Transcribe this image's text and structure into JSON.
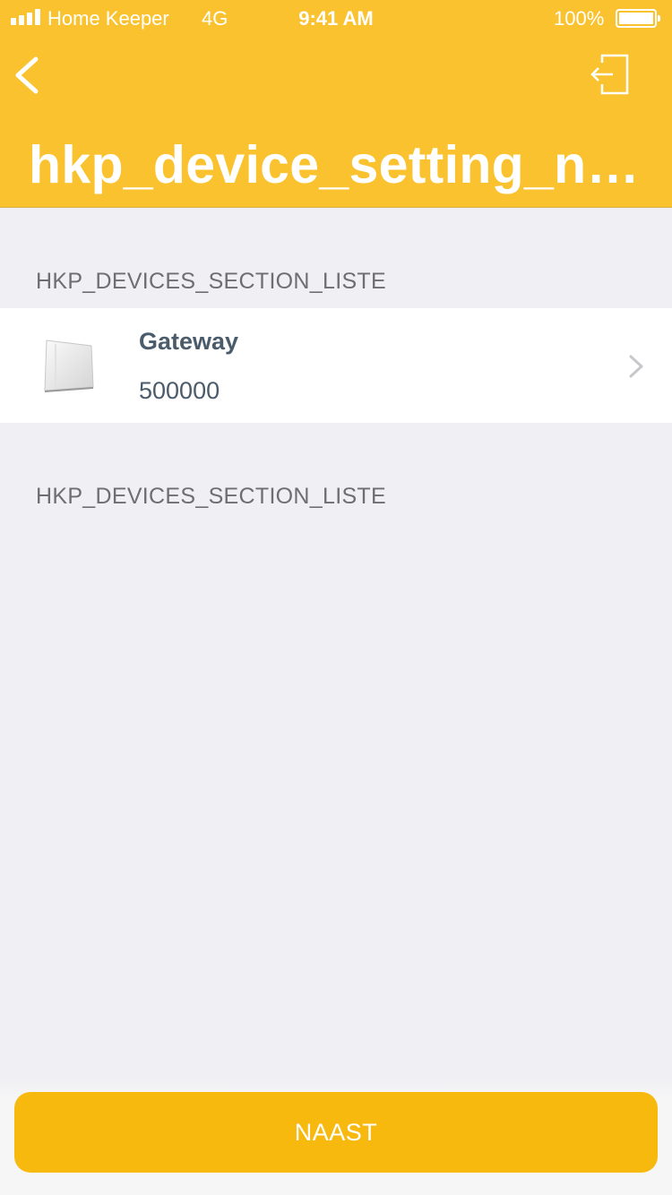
{
  "status_bar": {
    "carrier": "Home Keeper",
    "network": "4G",
    "time": "9:41 AM",
    "battery_percent": "100%"
  },
  "header": {
    "background_color": "#f9c22e",
    "back_icon": "chevron-left-icon",
    "logout_icon": "logout-icon",
    "title": "hkp_device_setting_na..."
  },
  "sections": [
    {
      "title": "HKP_DEVICES_SECTION_LISTE",
      "devices": [
        {
          "name": "Gateway",
          "id": "500000",
          "icon": "gateway-device-image"
        }
      ]
    },
    {
      "title": "HKP_DEVICES_SECTION_LISTE",
      "devices": []
    }
  ],
  "footer": {
    "button_label": "NAAST",
    "button_color": "#f8b90f"
  }
}
